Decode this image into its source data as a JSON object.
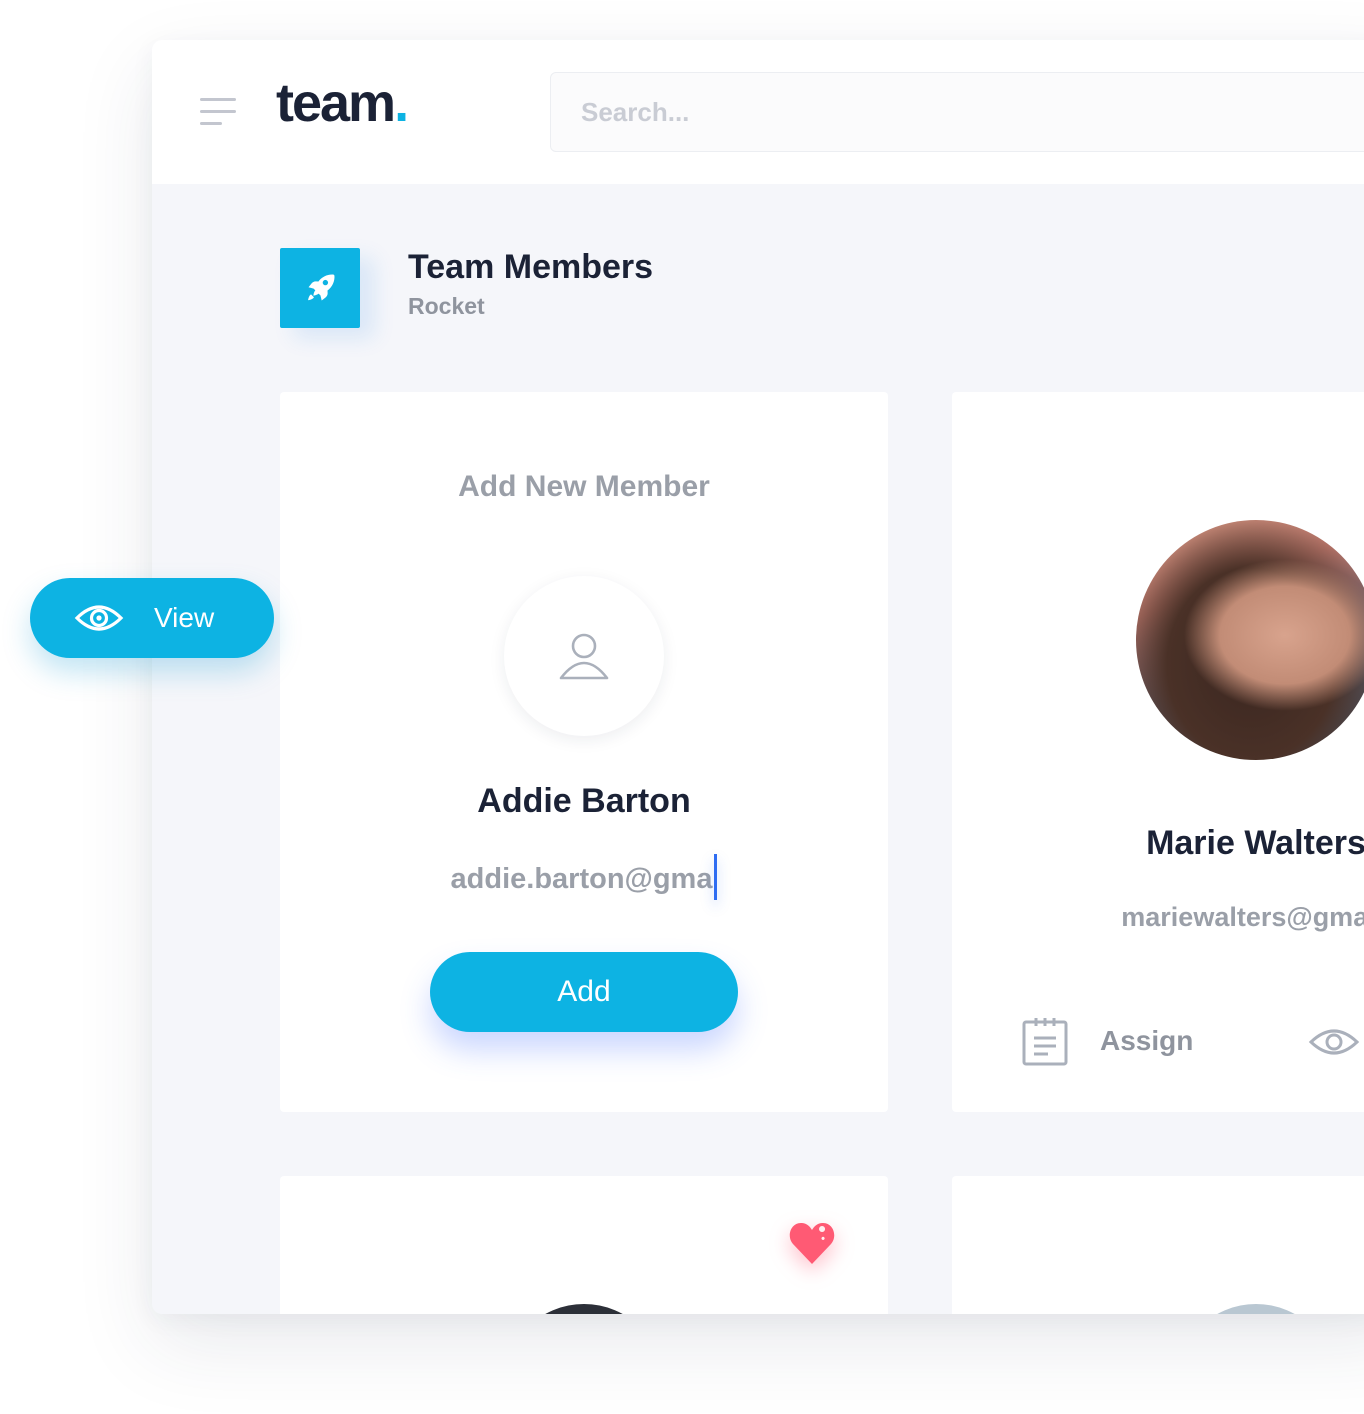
{
  "header": {
    "logo_text": "team",
    "logo_dot": ".",
    "search_placeholder": "Search..."
  },
  "page": {
    "title": "Team Members",
    "subtitle": "Rocket",
    "icon": "rocket-icon"
  },
  "add_member_card": {
    "title": "Add New Member",
    "name": "Addie Barton",
    "email_value": "addie.barton@gma",
    "add_label": "Add"
  },
  "member_card": {
    "name": "Marie Walters",
    "email": "mariewalters@gmail.",
    "assign_label": "Assign"
  },
  "floating_view": {
    "label": "View",
    "icon": "eye-icon"
  },
  "colors": {
    "accent": "#0db3e3",
    "text_dark": "#1b2236",
    "text_muted": "#9a9fa8",
    "heart": "#ff5a74",
    "caret": "#2f6df2"
  }
}
